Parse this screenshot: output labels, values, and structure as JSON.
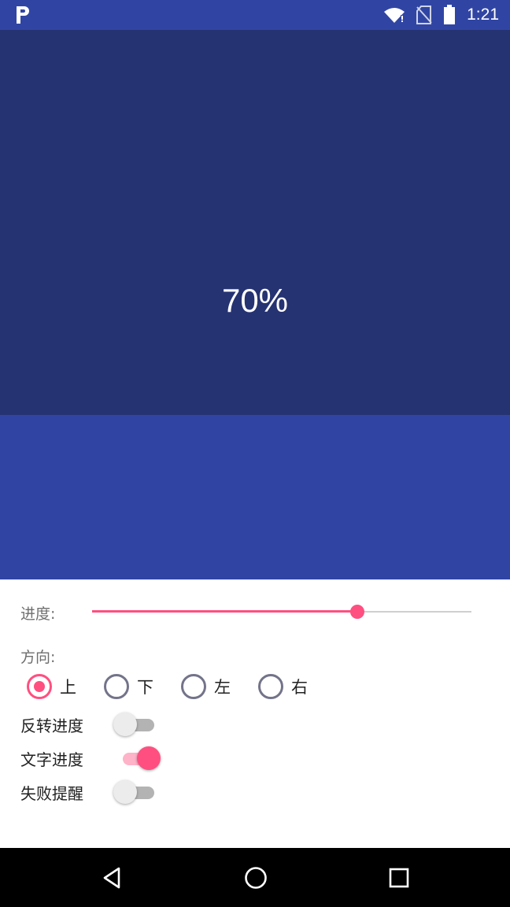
{
  "status_bar": {
    "time": "1:21",
    "icons": [
      "app-logo-icon",
      "wifi-icon",
      "no-sim-icon",
      "battery-icon"
    ]
  },
  "hero": {
    "progress_text": "70%",
    "progress_value": 0.7,
    "colors": {
      "background": "#3045a3",
      "fill": "#253372",
      "text": "#ffffff"
    }
  },
  "controls": {
    "progress_label": "进度:",
    "slider_value": 0.7,
    "direction_label": "方向:",
    "directions": [
      {
        "label": "上",
        "checked": true
      },
      {
        "label": "下",
        "checked": false
      },
      {
        "label": "左",
        "checked": false
      },
      {
        "label": "右",
        "checked": false
      }
    ],
    "toggles": [
      {
        "label": "反转进度",
        "on": false
      },
      {
        "label": "文字进度",
        "on": true
      },
      {
        "label": "失败提醒",
        "on": false
      }
    ],
    "accent_color": "#ff4f80"
  },
  "nav_bar": {
    "buttons": [
      "back-icon",
      "home-icon",
      "recents-icon"
    ]
  }
}
